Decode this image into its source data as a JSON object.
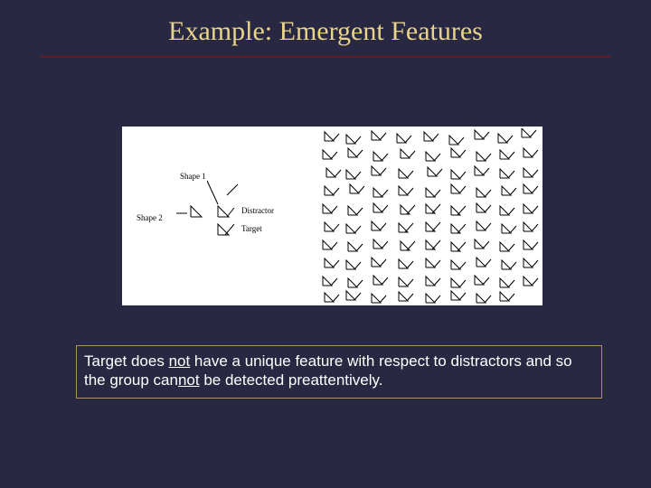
{
  "title": "Example: Emergent Features",
  "figure": {
    "labels": {
      "shape1": "Shape 1",
      "shape2": "Shape 2",
      "distractor": "Distractor",
      "target": "Target"
    }
  },
  "caption": {
    "pre1": "Target does ",
    "not1": "not",
    "mid1": " have a unique feature with respect to distractors and so the group can",
    "not2": "not",
    "post": " be detected preattentively."
  }
}
